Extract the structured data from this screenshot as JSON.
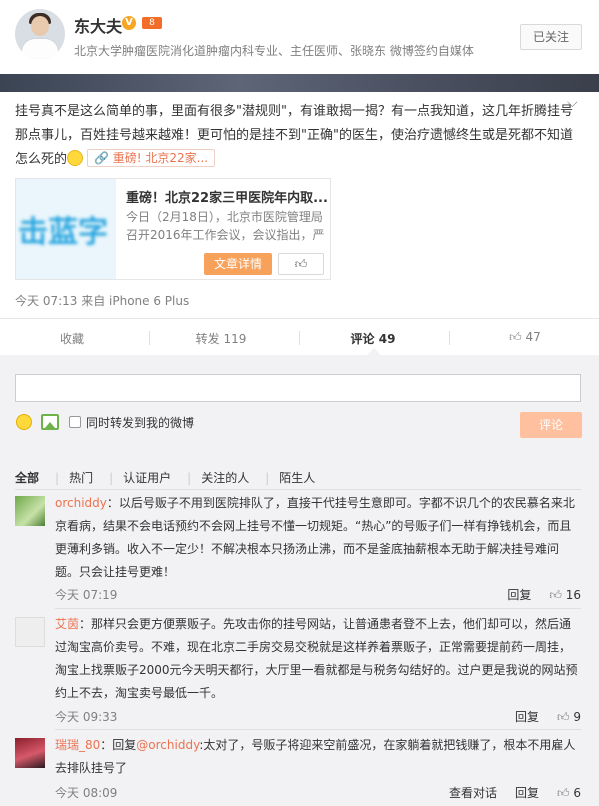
{
  "profile": {
    "name": "东大夫",
    "verified": "V",
    "vip": "8",
    "desc": "北京大学肿瘤医院消化道肿瘤内科专业、主任医师、张晓东 微博签约自媒体",
    "follow_label": "已关注"
  },
  "post": {
    "text": "挂号真不是这么简单的事，里面有很多\"潜规则\"，有谁敢揭一揭？有一点我知道，这几年折腾挂号那点事儿，百姓挂号越来越难！更可怕的是挂不到\"正确\"的医生，使治疗遗憾终生或是死都不知道怎么死的",
    "link_chip": "重磅! 北京22家...",
    "card": {
      "title": "重磅！北京22家三甲医院年内取...",
      "desc_line1": "今日（2月18日），北京市医院管理局",
      "desc_line2": "召开2016年工作会议，会议指出，严",
      "thumb_text": "击蓝字",
      "detail_label": "文章详情"
    },
    "meta": "今天 07:13 来自 iPhone 6 Plus"
  },
  "actions": {
    "fav": "收藏",
    "repost": "转发 119",
    "comment": "评论 49",
    "like": "47"
  },
  "compose": {
    "repost_label": "同时转发到我的微博",
    "submit_label": "评论"
  },
  "filters": [
    "全部",
    "热门",
    "认证用户",
    "关注的人",
    "陌生人"
  ],
  "comments": [
    {
      "name": "orchiddy",
      "text": "：以后号贩子不用到医院排队了，直接干代挂号生意即可。字都不识几个的农民慕名来北京看病，结果不会电话预约不会网上挂号不懂一切规矩。“热心”的号贩子们一样有挣钱机会，而且更薄利多销。收入不一定少！不解决根本只扬汤止沸，而不是釜底抽薪根本无助于解决挂号难问题。只会让挂号更难！",
      "time": "今天 07:19",
      "reply": "回复",
      "likes": "16"
    },
    {
      "name": "艾茵",
      "text": "：那样只会更方便票贩子。先攻击你的挂号网站，让普通患者登不上去，他们却可以，然后通过淘宝高价卖号。不难，现在北京二手房交易交税就是这样养着票贩子，正常需要提前药一周挂，淘宝上找票贩子2000元今天明天都行，大厅里一看就都是与税务勾结好的。过户更是我说的网站预约上不去，淘宝卖号最低一千。",
      "time": "今天 09:33",
      "reply": "回复",
      "likes": "9"
    },
    {
      "name": "瑞瑞_80",
      "text_pre": "：回复",
      "mention": "@orchiddy",
      "text": ":太对了，号贩子将迎来空前盛况，在家躺着就把钱赚了，根本不用雇人去排队挂号了",
      "time": "今天 08:09",
      "view_dialog": "查看对话",
      "reply": "回复",
      "likes": "6"
    }
  ]
}
